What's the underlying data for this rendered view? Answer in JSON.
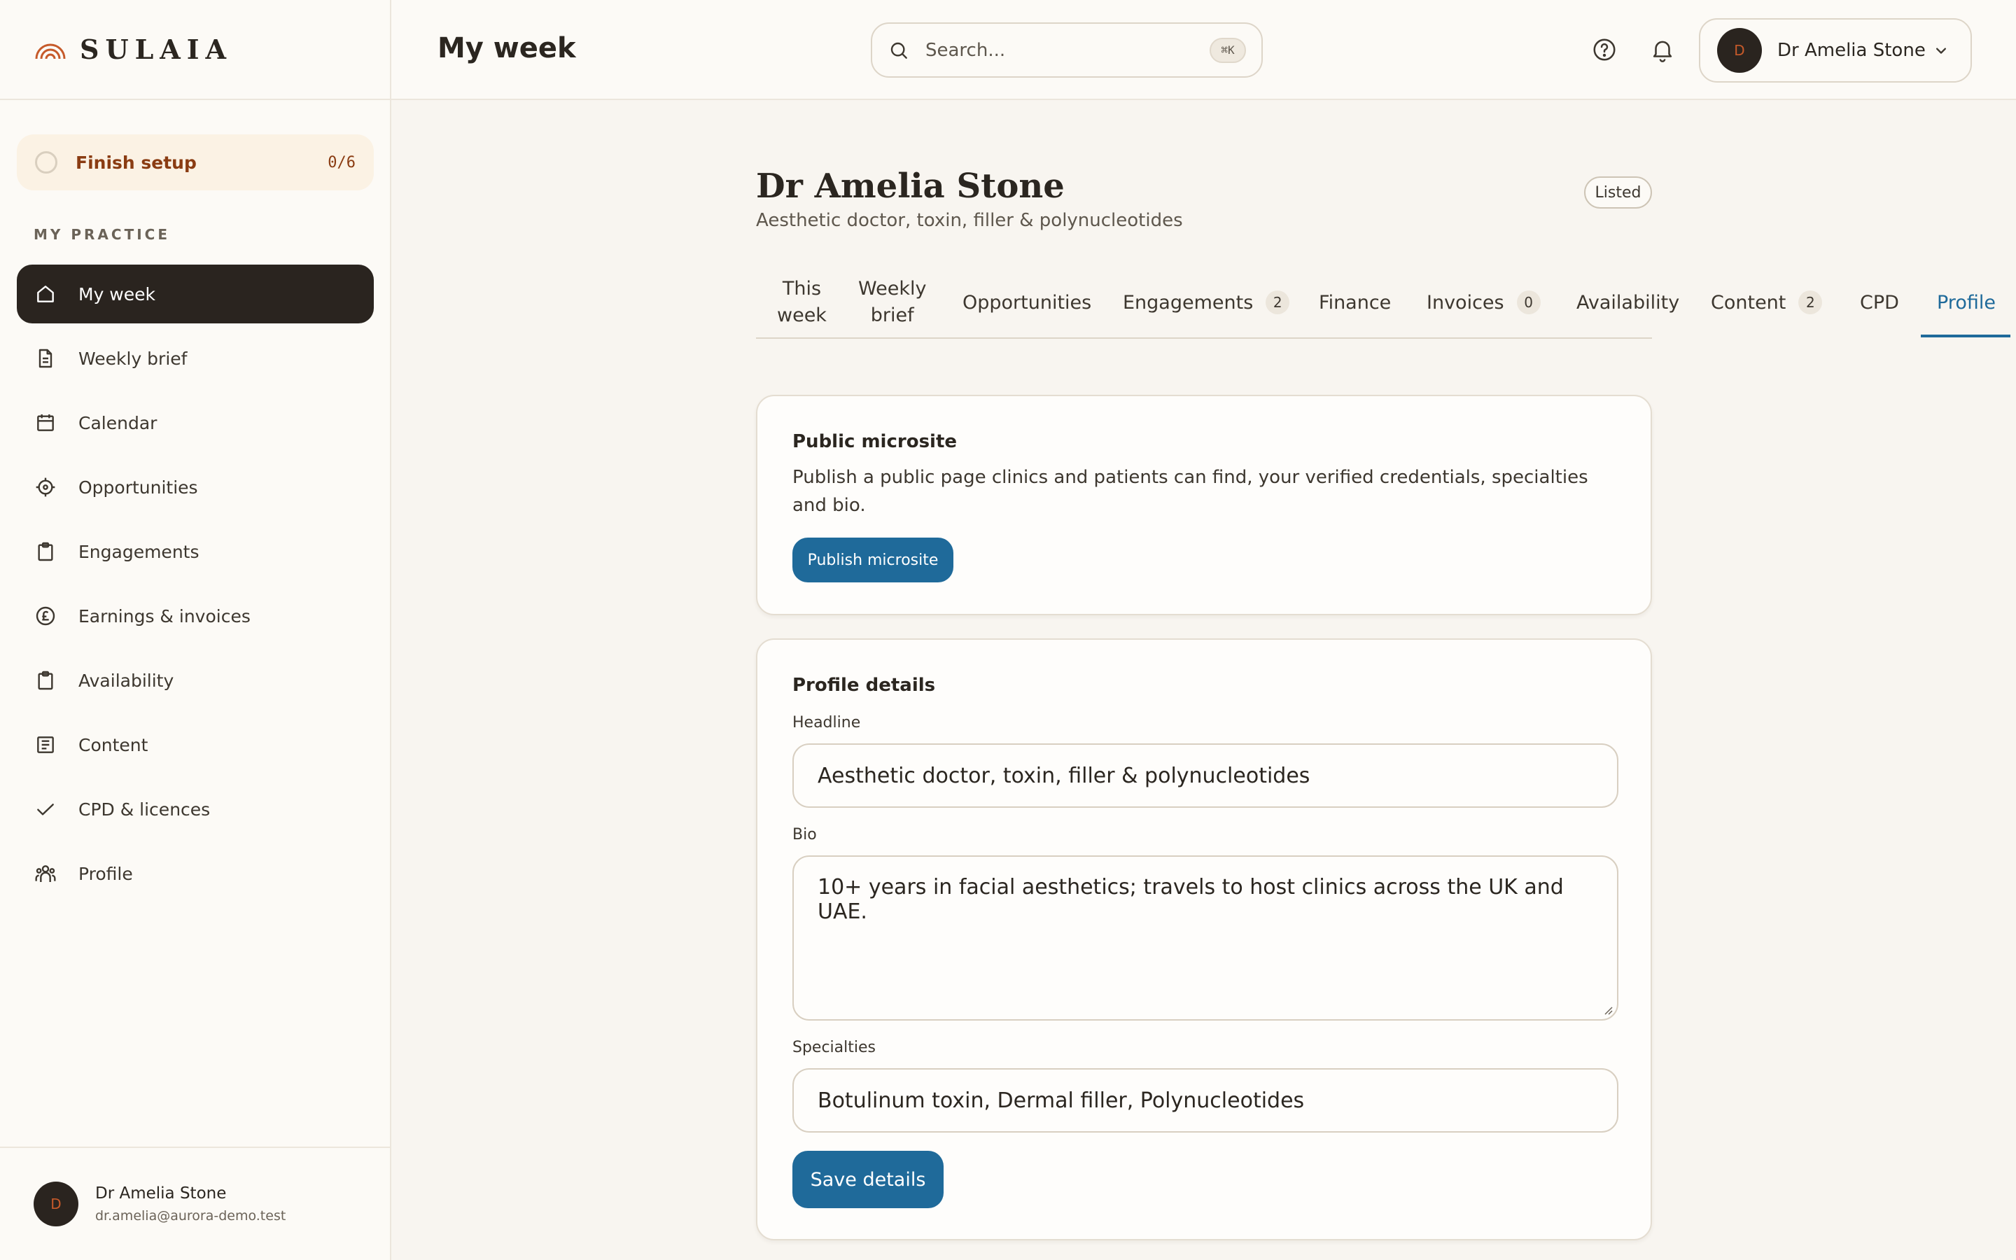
{
  "brand": {
    "name": "SULAIA"
  },
  "setup": {
    "label": "Finish setup",
    "count": "0/6"
  },
  "sidebar": {
    "section_label": "MY PRACTICE",
    "items": [
      {
        "label": "My week",
        "icon": "home-icon",
        "active": true
      },
      {
        "label": "Weekly brief",
        "icon": "document-icon"
      },
      {
        "label": "Calendar",
        "icon": "calendar-icon"
      },
      {
        "label": "Opportunities",
        "icon": "target-icon"
      },
      {
        "label": "Engagements",
        "icon": "clipboard-icon"
      },
      {
        "label": "Earnings & invoices",
        "icon": "pound-icon"
      },
      {
        "label": "Availability",
        "icon": "clipboard-icon"
      },
      {
        "label": "Content",
        "icon": "content-icon"
      },
      {
        "label": "CPD & licences",
        "icon": "check-icon"
      },
      {
        "label": "Profile",
        "icon": "people-icon"
      }
    ],
    "footer": {
      "avatar_initial": "D",
      "name": "Dr Amelia Stone",
      "email": "dr.amelia@aurora-demo.test"
    }
  },
  "header": {
    "title": "My week",
    "search_placeholder": "Search...",
    "search_shortcut": "⌘K",
    "user": {
      "avatar_initial": "D",
      "name": "Dr Amelia Stone"
    }
  },
  "profile": {
    "name": "Dr Amelia Stone",
    "subtitle": "Aesthetic doctor, toxin, filler & polynucleotides",
    "badge": "Listed"
  },
  "tabs": [
    {
      "label_line1": "This",
      "label_line2": "week"
    },
    {
      "label_line1": "Weekly",
      "label_line2": "brief"
    },
    {
      "label": "Opportunities"
    },
    {
      "label": "Engagements",
      "count": "2"
    },
    {
      "label": "Finance"
    },
    {
      "label": "Invoices",
      "count": "0"
    },
    {
      "label": "Availability"
    },
    {
      "label": "Content",
      "count": "2"
    },
    {
      "label": "CPD"
    },
    {
      "label": "Profile",
      "active": true
    }
  ],
  "microsite": {
    "title": "Public microsite",
    "description": "Publish a public page clinics and patients can find, your verified credentials, specialties and bio.",
    "button": "Publish microsite"
  },
  "details": {
    "title": "Profile details",
    "headline_label": "Headline",
    "headline_value": "Aesthetic doctor, toxin, filler & polynucleotides",
    "bio_label": "Bio",
    "bio_value": "10+ years in facial aesthetics; travels to host clinics across the UK and UAE.",
    "specialties_label": "Specialties",
    "specialties_value": "Botulinum toxin, Dermal filler, Polynucleotides",
    "save_button": "Save details"
  },
  "colors": {
    "accent": "#1f6a9a",
    "dark": "#2a241f",
    "setup_text": "#8a3c12",
    "brand_mark": "#c65a2a"
  }
}
